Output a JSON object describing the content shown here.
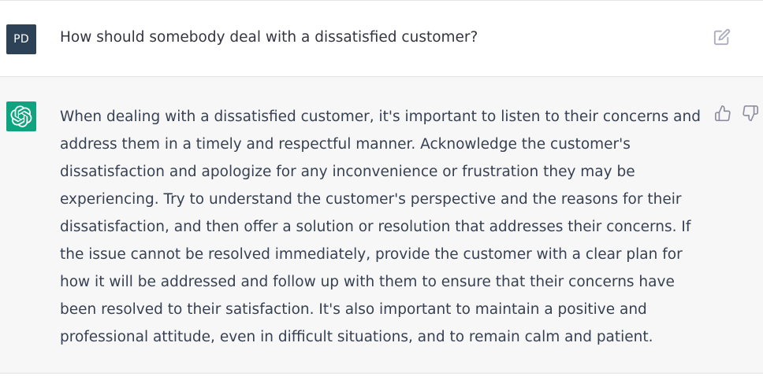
{
  "conversation": {
    "user_message": {
      "avatar_initials": "PD",
      "avatar_color": "#2e4257",
      "text": "How should somebody deal with a dissatisfied customer?",
      "edit_icon": "edit-icon"
    },
    "assistant_message": {
      "avatar_icon": "openai-logo-icon",
      "avatar_color": "#10a37f",
      "text": "When dealing with a dissatisfied customer, it's important to listen to their concerns and address them in a timely and respectful manner. Acknowledge the customer's dissatisfaction and apologize for any inconvenience or frustration they may be experiencing. Try to understand the customer's perspective and the reasons for their dissatisfaction, and then offer a solution or resolution that addresses their concerns. If the issue cannot be resolved immediately, provide the customer with a clear plan for how it will be addressed and follow up with them to ensure that their concerns have been resolved to their satisfaction. It's also important to maintain a positive and professional attitude, even in difficult situations, and to remain calm and patient.",
      "feedback_icons": [
        "thumbs-up-icon",
        "thumbs-down-icon"
      ]
    }
  }
}
